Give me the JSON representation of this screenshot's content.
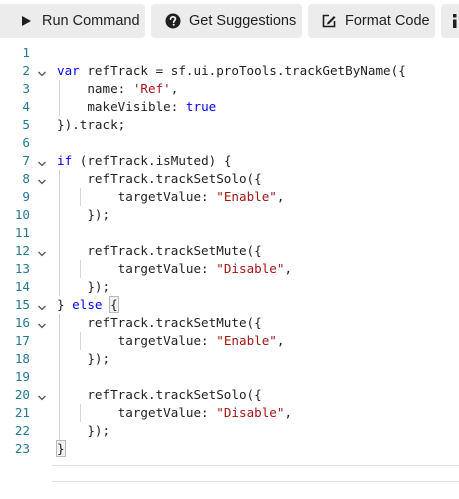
{
  "toolbar": {
    "run_label": "Run Command",
    "suggest_label": "Get Suggestions",
    "format_label": "Format Code",
    "icons": {
      "run": "play-icon",
      "suggest": "question-circle-icon",
      "format": "edit-square-icon",
      "more": "more-icon"
    }
  },
  "editor": {
    "line_numbers": [
      "1",
      "2",
      "3",
      "4",
      "5",
      "6",
      "7",
      "8",
      "9",
      "10",
      "11",
      "12",
      "13",
      "14",
      "15",
      "16",
      "17",
      "18",
      "19",
      "20",
      "21",
      "22",
      "23"
    ],
    "lines": [
      [],
      [
        {
          "t": "var",
          "c": "k"
        },
        {
          "t": " refTrack = sf.ui.proTools.trackGetByName({",
          "c": "p"
        }
      ],
      [
        {
          "t": "    name: ",
          "c": "p"
        },
        {
          "t": "'Ref'",
          "c": "s"
        },
        {
          "t": ",",
          "c": "p"
        }
      ],
      [
        {
          "t": "    makeVisible: ",
          "c": "p"
        },
        {
          "t": "true",
          "c": "k"
        }
      ],
      [
        {
          "t": "}).track;",
          "c": "p"
        }
      ],
      [],
      [
        {
          "t": "if",
          "c": "k"
        },
        {
          "t": " (refTrack.isMuted) {",
          "c": "p"
        }
      ],
      [
        {
          "t": "    refTrack.trackSetSolo({",
          "c": "p"
        }
      ],
      [
        {
          "t": "        targetValue: ",
          "c": "p"
        },
        {
          "t": "\"Enable\"",
          "c": "s"
        },
        {
          "t": ",",
          "c": "p"
        }
      ],
      [
        {
          "t": "    });",
          "c": "p"
        }
      ],
      [],
      [
        {
          "t": "    refTrack.trackSetMute({",
          "c": "p"
        }
      ],
      [
        {
          "t": "        targetValue: ",
          "c": "p"
        },
        {
          "t": "\"Disable\"",
          "c": "s"
        },
        {
          "t": ",",
          "c": "p"
        }
      ],
      [
        {
          "t": "    });",
          "c": "p"
        }
      ],
      [
        {
          "t": "} ",
          "c": "p"
        },
        {
          "t": "else",
          "c": "k"
        },
        {
          "t": " ",
          "c": "p"
        },
        {
          "t": "{",
          "c": "bm"
        }
      ],
      [
        {
          "t": "    refTrack.trackSetMute({",
          "c": "p"
        }
      ],
      [
        {
          "t": "        targetValue: ",
          "c": "p"
        },
        {
          "t": "\"Enable\"",
          "c": "s"
        },
        {
          "t": ",",
          "c": "p"
        }
      ],
      [
        {
          "t": "    });",
          "c": "p"
        }
      ],
      [],
      [
        {
          "t": "    refTrack.trackSetSolo({",
          "c": "p"
        }
      ],
      [
        {
          "t": "        targetValue: ",
          "c": "p"
        },
        {
          "t": "\"Disable\"",
          "c": "s"
        },
        {
          "t": ",",
          "c": "p"
        }
      ],
      [
        {
          "t": "    });",
          "c": "p"
        }
      ],
      [
        {
          "t": "}",
          "c": "bm"
        }
      ]
    ],
    "fold_lines": [
      2,
      7,
      8,
      12,
      15,
      16,
      20
    ],
    "active_line": 22,
    "colors": {
      "keyword": "#0000ff",
      "string": "#a31515",
      "line_number": "#237893",
      "text": "#1f1f1f",
      "toolbar_button_bg": "#ececec"
    }
  }
}
